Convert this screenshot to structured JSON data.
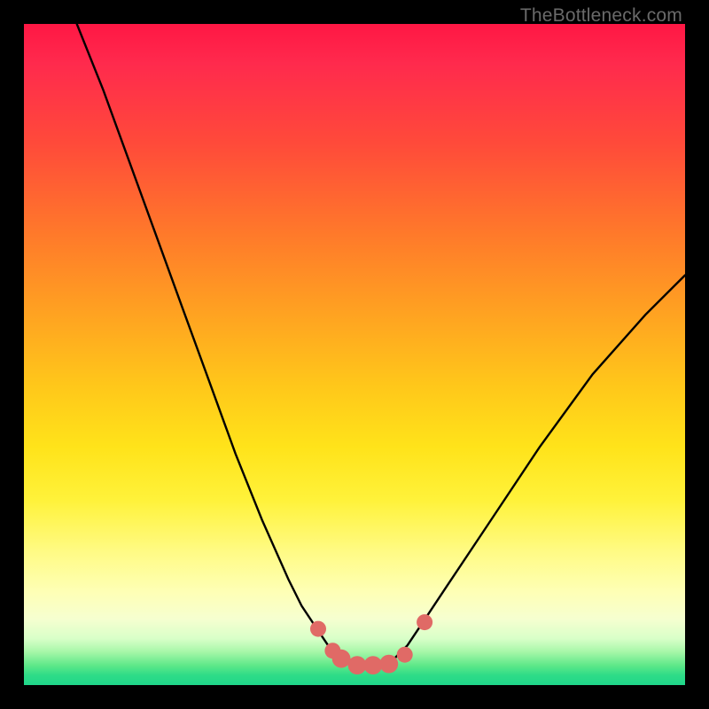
{
  "watermark": "TheBottleneck.com",
  "chart_data": {
    "type": "line",
    "title": "",
    "xlabel": "",
    "ylabel": "",
    "xlim": [
      0,
      100
    ],
    "ylim": [
      0,
      100
    ],
    "grid": false,
    "legend": false,
    "series": [
      {
        "name": "curve",
        "x": [
          8,
          12,
          16,
          20,
          24,
          28,
          32,
          36,
          40,
          42,
          44,
          46,
          48,
          50,
          52,
          54,
          56,
          58,
          60,
          64,
          70,
          78,
          86,
          94,
          100
        ],
        "y": [
          100,
          90,
          79,
          68,
          57,
          46,
          35,
          25,
          16,
          12,
          9,
          6,
          4,
          3,
          3,
          3,
          4,
          6,
          9,
          15,
          24,
          36,
          47,
          56,
          62
        ]
      }
    ],
    "markers": [
      {
        "x": 44.5,
        "y": 8.5,
        "r": 1.2
      },
      {
        "x": 46.7,
        "y": 5.2,
        "r": 1.2
      },
      {
        "x": 48.0,
        "y": 4.0,
        "r": 1.4
      },
      {
        "x": 50.4,
        "y": 3.0,
        "r": 1.4
      },
      {
        "x": 52.8,
        "y": 3.0,
        "r": 1.4
      },
      {
        "x": 55.2,
        "y": 3.2,
        "r": 1.4
      },
      {
        "x": 57.6,
        "y": 4.6,
        "r": 1.2
      },
      {
        "x": 60.6,
        "y": 9.5,
        "r": 1.2
      }
    ],
    "background_gradient": {
      "top": "#ff1744",
      "mid1": "#ffa321",
      "mid2": "#fff23a",
      "bottom": "#1fd68a"
    },
    "marker_color": "#e06a66",
    "curve_color": "#000000"
  }
}
